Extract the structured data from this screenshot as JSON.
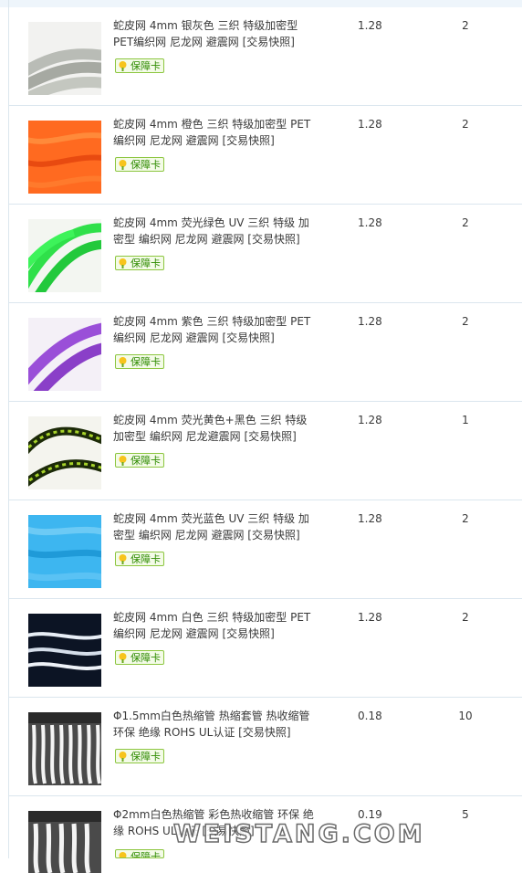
{
  "badge_label": "保障卡",
  "watermark": "WEISTANG.COM",
  "rows": [
    {
      "title": "蛇皮网 4mm 银灰色 三织 特级加密型 PET编织网 尼龙网 避震网",
      "snapshot": "[交易快照]",
      "price": "1.28",
      "qty": "2",
      "thumb_color": "#c9ccc6"
    },
    {
      "title": "蛇皮网 4mm 橙色 三织 特级加密型 PET编织网 尼龙网 避震网",
      "snapshot": "[交易快照]",
      "price": "1.28",
      "qty": "2",
      "thumb_color": "#ff5a1a"
    },
    {
      "title": "蛇皮网 4mm 荧光绿色 UV 三织 特级 加密型 编织网 尼龙网 避震网",
      "snapshot": "[交易快照]",
      "price": "1.28",
      "qty": "2",
      "thumb_color": "#2fe04a"
    },
    {
      "title": "蛇皮网 4mm 紫色 三织 特级加密型 PET编织网 尼龙网 避震网",
      "snapshot": "[交易快照]",
      "price": "1.28",
      "qty": "2",
      "thumb_color": "#9a4fd8"
    },
    {
      "title": "蛇皮网 4mm 荧光黄色+黑色 三织 特级加密型 编织网 尼龙避震网",
      "snapshot": "[交易快照]",
      "price": "1.28",
      "qty": "1",
      "thumb_color": "#6d8a1a"
    },
    {
      "title": "蛇皮网 4mm 荧光蓝色 UV 三织 特级 加密型 编织网 尼龙网 避震网",
      "snapshot": "[交易快照]",
      "price": "1.28",
      "qty": "2",
      "thumb_color": "#2fb0ee"
    },
    {
      "title": "蛇皮网 4mm 白色 三织 特级加密型 PET编织网 尼龙网 避震网",
      "snapshot": "[交易快照]",
      "price": "1.28",
      "qty": "2",
      "thumb_color": "#0c1424"
    },
    {
      "title": "Φ1.5mm白色热缩管 热缩套管 热收缩管 环保 绝缘 ROHS UL认证",
      "snapshot": "[交易快照]",
      "price": "0.18",
      "qty": "10",
      "thumb_color": "#555555"
    },
    {
      "title": "Φ2mm白色热缩管 彩色热收缩管 环保 绝缘 ROHS UL认证",
      "snapshot": "[交易快照]",
      "price": "0.19",
      "qty": "5",
      "thumb_color": "#555555"
    }
  ]
}
